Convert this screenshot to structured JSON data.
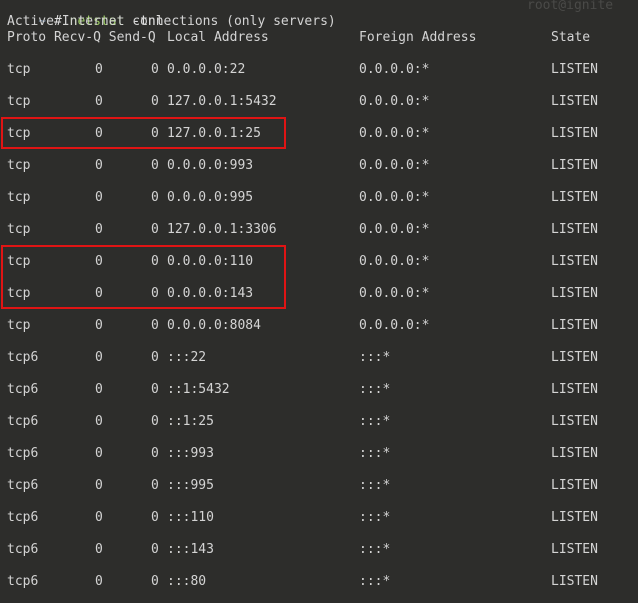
{
  "prompt": {
    "tilde": "~",
    "hash": "#",
    "command": "netstat",
    "args": "-tnl",
    "host": "root@ignite"
  },
  "title_line": "Active Internet connections (only servers)",
  "headers": {
    "proto_recv_send": "Proto Recv-Q Send-Q",
    "local": "Local Address",
    "foreign": "Foreign Address",
    "state": "State"
  },
  "rows": [
    {
      "proto": "tcp",
      "recv": "0",
      "send": "0",
      "local": "0.0.0.0:22",
      "foreign": "0.0.0.0:*",
      "state": "LISTEN"
    },
    {
      "proto": "tcp",
      "recv": "0",
      "send": "0",
      "local": "127.0.0.1:5432",
      "foreign": "0.0.0.0:*",
      "state": "LISTEN"
    },
    {
      "proto": "tcp",
      "recv": "0",
      "send": "0",
      "local": "127.0.0.1:25",
      "foreign": "0.0.0.0:*",
      "state": "LISTEN"
    },
    {
      "proto": "tcp",
      "recv": "0",
      "send": "0",
      "local": "0.0.0.0:993",
      "foreign": "0.0.0.0:*",
      "state": "LISTEN"
    },
    {
      "proto": "tcp",
      "recv": "0",
      "send": "0",
      "local": "0.0.0.0:995",
      "foreign": "0.0.0.0:*",
      "state": "LISTEN"
    },
    {
      "proto": "tcp",
      "recv": "0",
      "send": "0",
      "local": "127.0.0.1:3306",
      "foreign": "0.0.0.0:*",
      "state": "LISTEN"
    },
    {
      "proto": "tcp",
      "recv": "0",
      "send": "0",
      "local": "0.0.0.0:110",
      "foreign": "0.0.0.0:*",
      "state": "LISTEN"
    },
    {
      "proto": "tcp",
      "recv": "0",
      "send": "0",
      "local": "0.0.0.0:143",
      "foreign": "0.0.0.0:*",
      "state": "LISTEN"
    },
    {
      "proto": "tcp",
      "recv": "0",
      "send": "0",
      "local": "0.0.0.0:8084",
      "foreign": "0.0.0.0:*",
      "state": "LISTEN"
    },
    {
      "proto": "tcp6",
      "recv": "0",
      "send": "0",
      "local": ":::22",
      "foreign": ":::*",
      "state": "LISTEN"
    },
    {
      "proto": "tcp6",
      "recv": "0",
      "send": "0",
      "local": "::1:5432",
      "foreign": ":::*",
      "state": "LISTEN"
    },
    {
      "proto": "tcp6",
      "recv": "0",
      "send": "0",
      "local": "::1:25",
      "foreign": ":::*",
      "state": "LISTEN"
    },
    {
      "proto": "tcp6",
      "recv": "0",
      "send": "0",
      "local": ":::993",
      "foreign": ":::*",
      "state": "LISTEN"
    },
    {
      "proto": "tcp6",
      "recv": "0",
      "send": "0",
      "local": ":::995",
      "foreign": ":::*",
      "state": "LISTEN"
    },
    {
      "proto": "tcp6",
      "recv": "0",
      "send": "0",
      "local": ":::110",
      "foreign": ":::*",
      "state": "LISTEN"
    },
    {
      "proto": "tcp6",
      "recv": "0",
      "send": "0",
      "local": ":::143",
      "foreign": ":::*",
      "state": "LISTEN"
    },
    {
      "proto": "tcp6",
      "recv": "0",
      "send": "0",
      "local": ":::80",
      "foreign": ":::*",
      "state": "LISTEN"
    }
  ],
  "highlight_color": "#e01414",
  "highlighted_rows": [
    [
      2,
      2
    ],
    [
      6,
      7
    ]
  ]
}
